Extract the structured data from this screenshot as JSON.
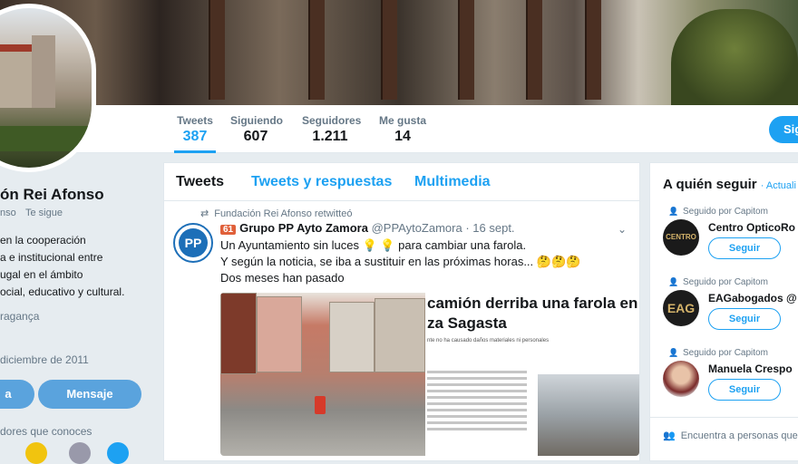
{
  "nav": {
    "stats": [
      {
        "label": "Tweets",
        "value": "387"
      },
      {
        "label": "Siguiendo",
        "value": "607"
      },
      {
        "label": "Seguidores",
        "value": "1.211"
      },
      {
        "label": "Me gusta",
        "value": "14"
      }
    ],
    "follow_button": "Sig"
  },
  "profile": {
    "name": "ón Rei Afonso",
    "handle": "nso",
    "follows_you": "Te sigue",
    "bio": [
      "en la cooperación",
      "a e institucional entre",
      "ugal en el ámbito",
      "ocial, educativo y cultural."
    ],
    "location": "raganҫa",
    "joined": "diciembre de 2011",
    "button_left": "a",
    "button_message": "Mensaje",
    "known_followers": "dores que conoces"
  },
  "timeline": {
    "tabs": [
      "Tweets",
      "Tweets y respuestas",
      "Multimedia"
    ],
    "retweeted_by": "Fundación Rei Afonso retwitteó",
    "tweet": {
      "badge": "61",
      "author": "Grupo PP Ayto Zamora",
      "handle": "@PPAytoZamora",
      "date": "· 16 sept.",
      "lines": [
        "Un Ayuntamiento sin luces 💡 💡 para cambiar una farola.",
        "Y según la noticia, se iba a sustituir en las próximas horas... 🤔🤔🤔",
        "Dos meses han pasado"
      ],
      "avatar_text": "PP",
      "news_headline_1": "camión derriba una farola en l",
      "news_headline_2": "za Sagasta",
      "news_sub": "nte no ha causado daños materiales ni personales"
    }
  },
  "sidebar": {
    "title": "A quién seguir",
    "update": "· Actuali",
    "suggestions": [
      {
        "context": "Seguido por Capitom",
        "name": "Centro OpticoRo",
        "avatar_text": "CENTRO OPTICO",
        "follow": "Seguir"
      },
      {
        "context": "Seguido por Capitom",
        "name": "EAGabogados @",
        "avatar_text": "EAG",
        "follow": "Seguir"
      },
      {
        "context": "Seguido por Capitom",
        "name": "Manuela Crespo",
        "avatar_text": "",
        "follow": "Seguir"
      }
    ],
    "find_people": "Encuentra a personas que co"
  },
  "colors": {
    "accent": "#1da1f2",
    "background": "#e6ecf0"
  }
}
